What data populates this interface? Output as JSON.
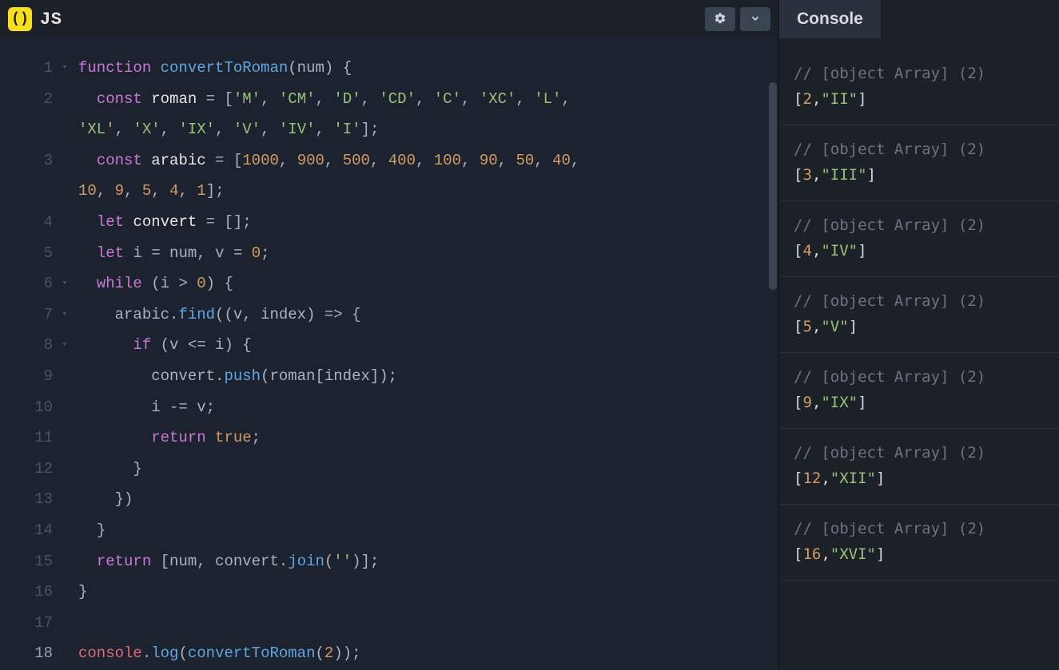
{
  "header": {
    "lang_label": "JS",
    "logo_text": "()"
  },
  "gutter": {
    "lines": [
      "1",
      "2",
      "3",
      "4",
      "5",
      "6",
      "7",
      "8",
      "9",
      "10",
      "11",
      "12",
      "13",
      "14",
      "15",
      "16",
      "17",
      "18"
    ],
    "folds": [
      1,
      6,
      7,
      8
    ]
  },
  "code": {
    "kw_function": "function",
    "fn_convertToRoman": "convertToRoman",
    "paren_open": "(",
    "param_num": "num",
    "paren_close": ")",
    "brace_open": " {",
    "kw_const": "const",
    "id_roman": "roman",
    "op_assign": " = ",
    "roman_arr_1": "['M', 'CM', 'D', 'CD', 'C', 'XC', 'L', ",
    "roman_arr_2": "'XL', 'X', 'IX', 'V', 'IV', 'I']",
    "semicolon": ";",
    "id_arabic": "arabic",
    "arabic_arr_1": "[1000, 900, 500, 400, 100, 90, 50, 40, ",
    "arabic_arr_2": "10, 9, 5, 4, 1]",
    "kw_let": "let",
    "id_convert": "convert",
    "empty_arr": " = [];",
    "line5": "let i = num, v = 0;",
    "kw_while": "while",
    "cond_while": " (i > 0) {",
    "fn_find": "find",
    "find_args": "((v, index) => {",
    "kw_if": "if",
    "cond_if": " (v <= i) {",
    "fn_push": "push",
    "push_args": "(roman[index]);",
    "line10": "i -= v;",
    "kw_return": "return",
    "kw_true": "true",
    "close_brace": "}",
    "close_paren_brace": "})",
    "return_val": " [num, convert.",
    "fn_join": "join",
    "join_args": "('')];",
    "id_console": "console",
    "fn_log": "log",
    "log_num": "2",
    "log_close": "));"
  },
  "console": {
    "title": "Console",
    "entries": [
      {
        "comment": "// [object Array] (2)",
        "num": "2",
        "str": "\"II\""
      },
      {
        "comment": "// [object Array] (2)",
        "num": "3",
        "str": "\"III\""
      },
      {
        "comment": "// [object Array] (2)",
        "num": "4",
        "str": "\"IV\""
      },
      {
        "comment": "// [object Array] (2)",
        "num": "5",
        "str": "\"V\""
      },
      {
        "comment": "// [object Array] (2)",
        "num": "9",
        "str": "\"IX\""
      },
      {
        "comment": "// [object Array] (2)",
        "num": "12",
        "str": "\"XII\""
      },
      {
        "comment": "// [object Array] (2)",
        "num": "16",
        "str": "\"XVI\""
      }
    ]
  }
}
